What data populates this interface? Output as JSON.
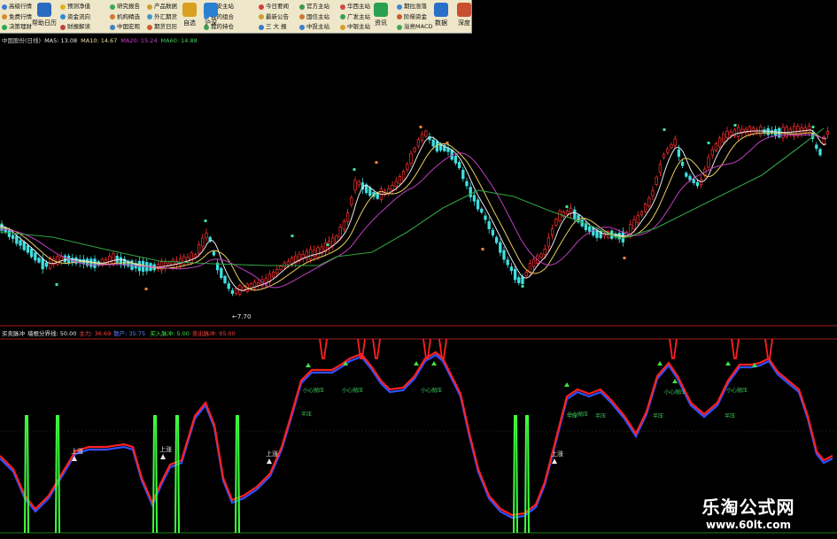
{
  "toolbar": {
    "columns": [
      {
        "items": [
          {
            "label": "高级行情",
            "color": "#3a7ad8"
          },
          {
            "label": "免费行情",
            "color": "#d88a2a"
          },
          {
            "label": "决策理财",
            "color": "#2aa84a"
          }
        ]
      },
      {
        "items": [
          {
            "label": "预测净值",
            "color": "#e0b020"
          },
          {
            "label": "资金流向",
            "color": "#2a8ad8"
          },
          {
            "label": "财报解读",
            "color": "#c04040"
          }
        ]
      },
      {
        "items": [
          {
            "label": "研究报告",
            "color": "#3aa858"
          },
          {
            "label": "机构精选",
            "color": "#d07a30"
          },
          {
            "label": "中国宏观",
            "color": "#4080c0"
          }
        ]
      },
      {
        "items": [
          {
            "label": "产品数据",
            "color": "#c8a030"
          },
          {
            "label": "外汇期货",
            "color": "#3a9ad0"
          },
          {
            "label": "期货日历",
            "color": "#d05a30"
          }
        ]
      },
      {
        "items": [
          {
            "label": "平安主站",
            "color": "#e0a020"
          },
          {
            "label": "我的组合",
            "color": "#3a88d0"
          },
          {
            "label": "我的持仓",
            "color": "#40a050"
          }
        ]
      },
      {
        "items": [
          {
            "label": "今日要闻",
            "color": "#d04040"
          },
          {
            "label": "最新公告",
            "color": "#d0a030"
          },
          {
            "label": "三 大 报",
            "color": "#3a78c8"
          }
        ]
      },
      {
        "items": [
          {
            "label": "官方主站",
            "color": "#3a9a50"
          },
          {
            "label": "国信主站",
            "color": "#c87a30"
          },
          {
            "label": "中投主站",
            "color": "#3a80d0"
          }
        ]
      },
      {
        "items": [
          {
            "label": "华西主站",
            "color": "#d04848"
          },
          {
            "label": "广发主站",
            "color": "#3aa050"
          },
          {
            "label": "中银主站",
            "color": "#d0a028"
          }
        ]
      },
      {
        "items": [
          {
            "label": "期拉涨落",
            "color": "#3a88d8"
          },
          {
            "label": "阶梯资金",
            "color": "#c85a30"
          },
          {
            "label": "溢亮MACD",
            "color": "#40a858"
          }
        ]
      }
    ],
    "big_buttons": [
      {
        "label": "帮助日历",
        "color": "#2a6ac0"
      },
      {
        "label": "自选",
        "color": "#d8a020"
      },
      {
        "label": "沪深",
        "color": "#2a80d0"
      },
      {
        "label": "资讯",
        "color": "#2aa050"
      },
      {
        "label": "数据",
        "color": "#2a70c8"
      },
      {
        "label": "深度",
        "color": "#c85030"
      }
    ]
  },
  "ma_labels": [
    {
      "text": "中国股份(日线)",
      "color": "#cccccc"
    },
    {
      "text": "MA5: 13.08",
      "color": "#e8e8e8"
    },
    {
      "text": "MA10: 14.67",
      "color": "#e8e0a0"
    },
    {
      "text": "MA20: 15.24",
      "color": "#d040d0"
    },
    {
      "text": "MA60: 14.88",
      "color": "#40d060"
    }
  ],
  "indicator_labels": [
    {
      "text": "买卖脉冲",
      "color": "#e8e8e8"
    },
    {
      "text": "墙根分界线: 50.00",
      "color": "#e8e8e8"
    },
    {
      "text": "主力: 36.69",
      "color": "#ff4040"
    },
    {
      "text": "散户: 35.75",
      "color": "#6080ff"
    },
    {
      "text": "   买入脉冲: 5.00",
      "color": "#40e040"
    },
    {
      "text": "卖出脉冲: 95.00",
      "color": "#ff4040"
    }
  ],
  "price_low_label": "←7.70",
  "annotations": {
    "shangzhang": "上涨",
    "xiaoxin": "小心抛压",
    "banshi": "半压"
  },
  "watermark": {
    "title": "乐淘公式网",
    "url": "www.60lt.com"
  },
  "colors": {
    "up": "#ff3030",
    "down": "#40e0e0",
    "bg": "#000000",
    "main": "#ff2020",
    "retail": "#3050ff",
    "buy": "#40ff40"
  }
}
